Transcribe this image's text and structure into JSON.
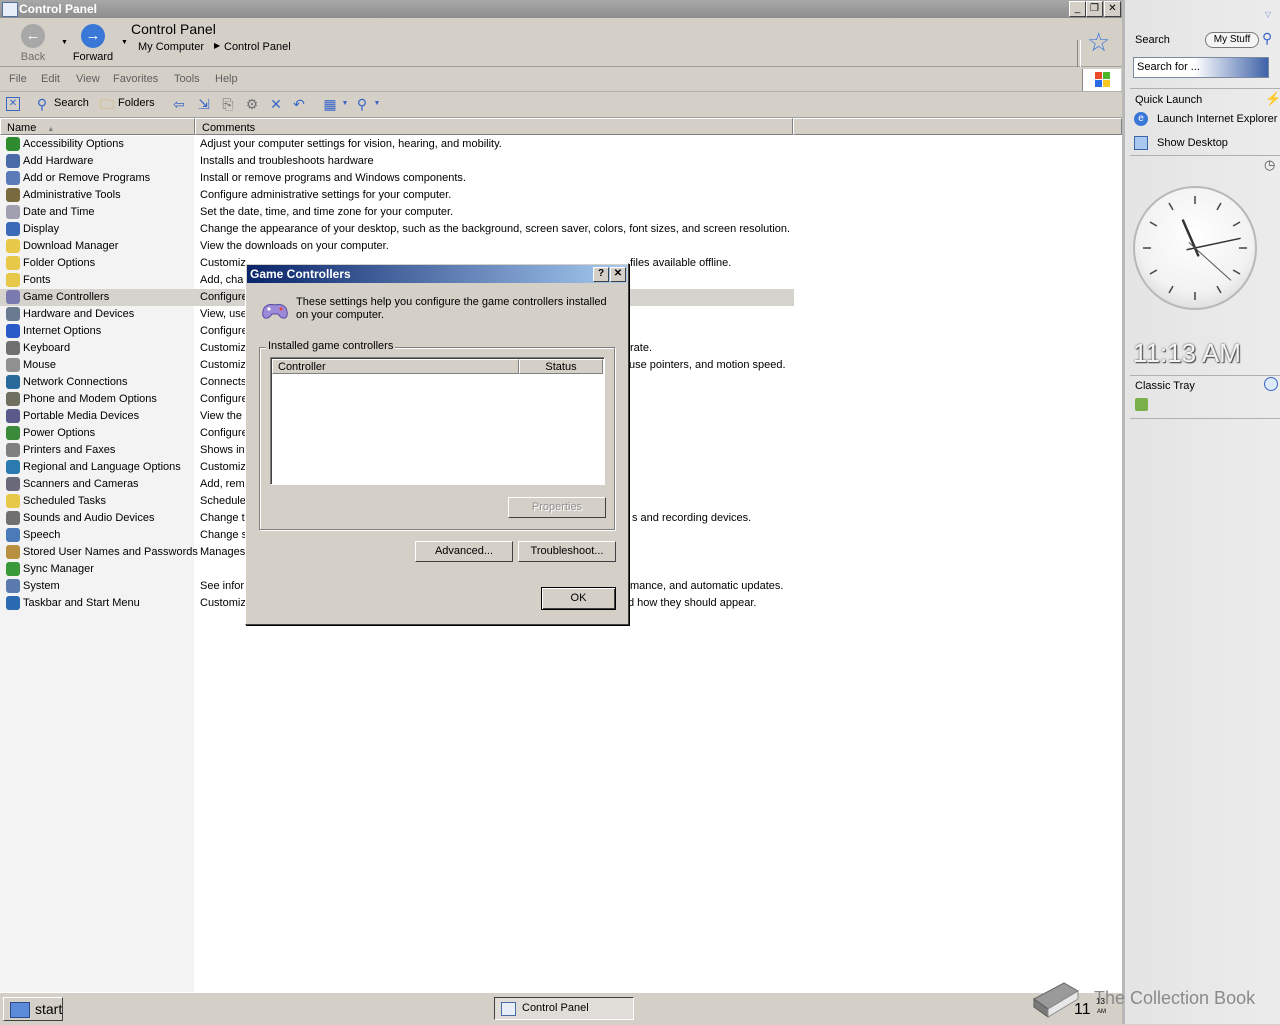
{
  "window": {
    "title": "Control Panel"
  },
  "nav": {
    "back_label": "Back",
    "forward_label": "Forward",
    "title": "Control Panel",
    "breadcrumb": [
      "My Computer",
      "Control Panel"
    ]
  },
  "menu": [
    "File",
    "Edit",
    "View",
    "Favorites",
    "Tools",
    "Help"
  ],
  "toolbar": {
    "search_label": "Search",
    "folders_label": "Folders"
  },
  "list": {
    "headers": {
      "name": "Name",
      "comments": "Comments"
    },
    "rows": [
      {
        "name": "Accessibility Options",
        "comment": "Adjust your computer settings for vision, hearing, and mobility.",
        "icon": "accessibility-icon",
        "color": "#2e8b2e"
      },
      {
        "name": "Add Hardware",
        "comment": "Installs and troubleshoots hardware",
        "icon": "add-hardware-icon",
        "color": "#4a6aa8"
      },
      {
        "name": "Add or Remove Programs",
        "comment": "Install or remove programs and Windows components.",
        "icon": "add-remove-programs-icon",
        "color": "#5a7ab8"
      },
      {
        "name": "Administrative Tools",
        "comment": "Configure administrative settings for your computer.",
        "icon": "admin-tools-icon",
        "color": "#7a6a40"
      },
      {
        "name": "Date and Time",
        "comment": "Set the date, time, and time zone for your computer.",
        "icon": "clock-icon",
        "color": "#a0a0b0"
      },
      {
        "name": "Display",
        "comment": "Change the appearance of your desktop, such as the background, screen saver, colors, font sizes, and screen resolution.",
        "icon": "display-icon",
        "color": "#3a6ab8"
      },
      {
        "name": "Download Manager",
        "comment": "View the downloads on your computer.",
        "icon": "folder-icon",
        "color": "#e8c848"
      },
      {
        "name": "Folder Options",
        "comment": "Customize the display of files and folders, change file associations, and make network files available offline.",
        "comment_visible": "Customiz",
        "comment_tail": "files available offline.",
        "icon": "folder-options-icon",
        "color": "#e8c848"
      },
      {
        "name": "Fonts",
        "comment": "Add, cha",
        "icon": "fonts-folder-icon",
        "color": "#e8c848"
      },
      {
        "name": "Game Controllers",
        "comment": "Configure",
        "icon": "game-controller-icon",
        "color": "#7a7ab0",
        "selected": true
      },
      {
        "name": "Hardware and Devices",
        "comment": "View, use",
        "icon": "hardware-icon",
        "color": "#6a7a90"
      },
      {
        "name": "Internet Options",
        "comment": "Configure",
        "icon": "globe-icon",
        "color": "#2a5ac8"
      },
      {
        "name": "Keyboard",
        "comment": "Customiz",
        "comment_tail": "rate.",
        "icon": "keyboard-icon",
        "color": "#707070"
      },
      {
        "name": "Mouse",
        "comment": "Customiz",
        "comment_tail": "use pointers, and motion speed.",
        "icon": "mouse-icon",
        "color": "#909090"
      },
      {
        "name": "Network Connections",
        "comment": "Connects",
        "icon": "network-icon",
        "color": "#2a6a9a"
      },
      {
        "name": "Phone and Modem Options",
        "comment": "Configure",
        "icon": "phone-icon",
        "color": "#707060"
      },
      {
        "name": "Portable Media Devices",
        "comment": "View the",
        "icon": "media-device-icon",
        "color": "#5a5a8a"
      },
      {
        "name": "Power Options",
        "comment": "Configure",
        "icon": "power-icon",
        "color": "#3a8a3a"
      },
      {
        "name": "Printers and Faxes",
        "comment": "Shows ins",
        "icon": "printer-icon",
        "color": "#808080"
      },
      {
        "name": "Regional and Language Options",
        "comment": "Customiz",
        "icon": "globe-icon",
        "color": "#2a7ab0"
      },
      {
        "name": "Scanners and Cameras",
        "comment": "Add, rem",
        "icon": "scanner-icon",
        "color": "#6a6a7a"
      },
      {
        "name": "Scheduled Tasks",
        "comment": "Schedule",
        "icon": "scheduled-tasks-icon",
        "color": "#e8c848"
      },
      {
        "name": "Sounds and Audio Devices",
        "comment": "Change t",
        "comment_tail": "s and recording devices.",
        "icon": "speaker-icon",
        "color": "#707070"
      },
      {
        "name": "Speech",
        "comment": "Change s",
        "icon": "speech-icon",
        "color": "#4a7ab8"
      },
      {
        "name": "Stored User Names and Passwords",
        "comment": "Manages",
        "icon": "key-icon",
        "color": "#b89040"
      },
      {
        "name": "Sync Manager",
        "comment": "",
        "icon": "sync-icon",
        "color": "#3a9a3a"
      },
      {
        "name": "System",
        "comment": "See infor",
        "comment_tail": "mance, and automatic updates.",
        "icon": "system-icon",
        "color": "#5a7ab0"
      },
      {
        "name": "Taskbar and Start Menu",
        "comment": "Customiz",
        "comment_tail": "d how they should appear.",
        "icon": "taskbar-icon",
        "color": "#2a6ab0"
      }
    ]
  },
  "dialog": {
    "title": "Game Controllers",
    "help": "?",
    "close": "✕",
    "description": "These settings help you configure the game controllers installed on your computer.",
    "group_label": "Installed game controllers",
    "columns": {
      "controller": "Controller",
      "status": "Status"
    },
    "buttons": {
      "properties": "Properties",
      "advanced": "Advanced...",
      "troubleshoot": "Troubleshoot...",
      "ok": "OK"
    }
  },
  "sidebar": {
    "search_label": "Search",
    "my_stuff": "My Stuff",
    "search_placeholder": "Search for ...",
    "quick_launch_title": "Quick Launch",
    "quick_launch": [
      "Launch Internet Explorer",
      "Show Desktop"
    ],
    "time": "11:13 AM",
    "clock": {
      "hour": 11,
      "minute": 13,
      "second": 22
    },
    "classic_tray_title": "Classic Tray"
  },
  "taskbar": {
    "start_label": "start",
    "task": "Control Panel",
    "clock_hour": "11",
    "clock_minute": "13",
    "clock_ampm": "AM"
  },
  "watermark": "The Collection Book"
}
